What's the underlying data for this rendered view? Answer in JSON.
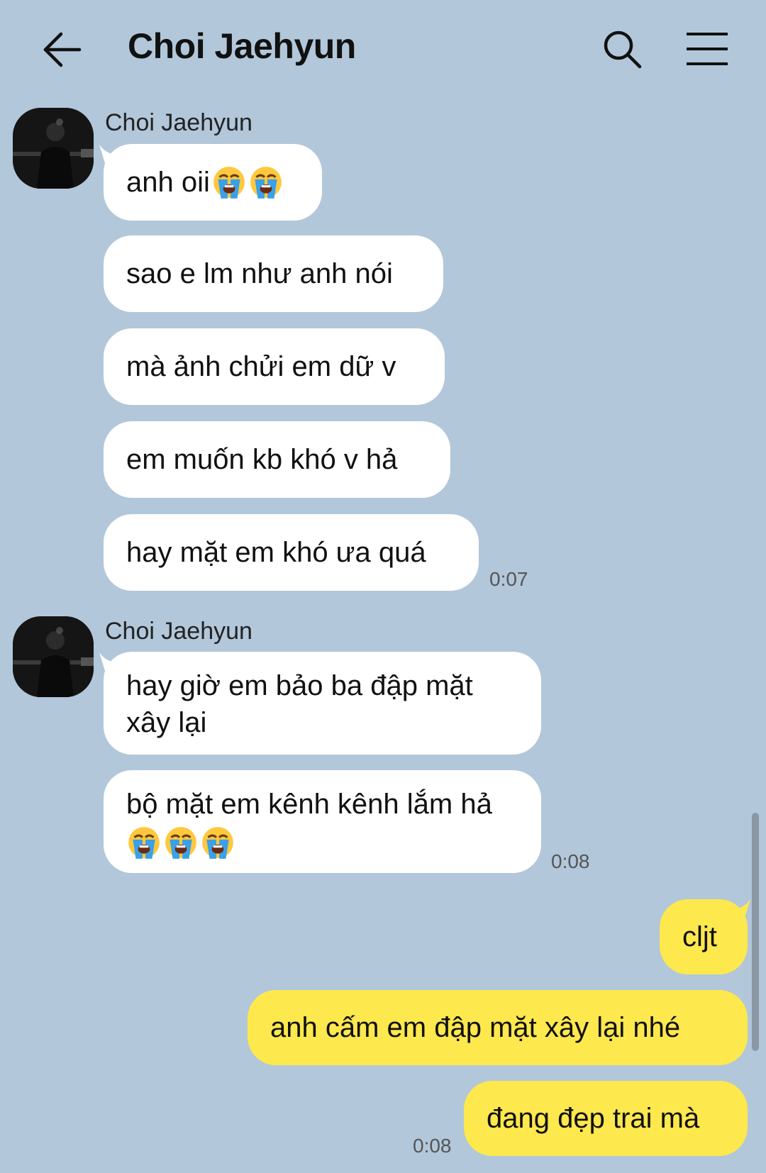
{
  "header": {
    "title": "Choi Jaehyun"
  },
  "groups": [
    {
      "sender": "Choi Jaehyun",
      "messages": [
        "anh oii",
        "sao e lm như anh nói",
        "mà ảnh chửi em dữ v",
        "em muốn kb khó v hả",
        "hay mặt em khó ưa quá"
      ],
      "time": "0:07"
    },
    {
      "sender": "Choi Jaehyun",
      "messages": [
        "hay giờ em bảo ba đập mặt xây lại",
        "bộ mặt em kênh kênh lắm hả"
      ],
      "time": "0:08"
    }
  ],
  "mine": {
    "messages": [
      "cljt",
      "anh cấm em đập mặt xây lại nhé",
      "đang đẹp trai mà"
    ],
    "time": "0:08"
  },
  "emoji": {
    "name": "loudly-crying-face",
    "face_color": "#ffc83d",
    "tear_color": "#3aa0e8"
  },
  "colors": {
    "background": "#b2c7da",
    "incoming_bubble": "#ffffff",
    "outgoing_bubble": "#fde84d"
  }
}
